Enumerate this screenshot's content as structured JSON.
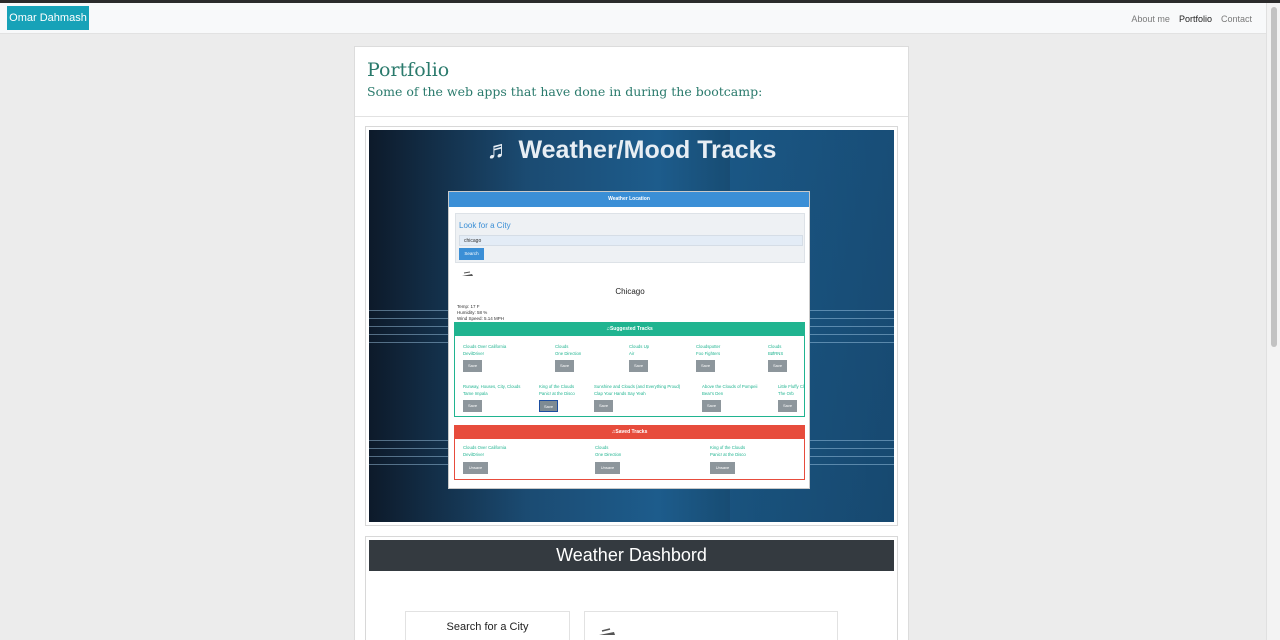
{
  "navbar": {
    "brand": "Omar Dahmash",
    "links": [
      "About me",
      "Portfolio",
      "Contact"
    ]
  },
  "header": {
    "title": "Portfolio",
    "subtitle": "Some of the web apps that have done in during the bootcamp:"
  },
  "project1": {
    "title": "Weather/Mood Tracks",
    "app_header": "Weather Location",
    "look_title": "Look for a City",
    "search_value": "chicago",
    "search_button": "Search",
    "city": "Chicago",
    "temp": "Temp: 17 F",
    "humidity": "Humidity: 58 %",
    "wind": "Wind Speed: 5.14 MPH",
    "suggested_header": "Suggested Tracks",
    "saved_header": "Saved Tracks",
    "save_label": "Save",
    "unsave_label": "Unsave",
    "suggested_tracks": [
      {
        "title": "Clouds Over California",
        "artist": "DevilDriver"
      },
      {
        "title": "Clouds",
        "artist": "One Direction"
      },
      {
        "title": "Clouds Up",
        "artist": "Air"
      },
      {
        "title": "Cloudspotter",
        "artist": "Foo Fighters"
      },
      {
        "title": "Clouds",
        "artist": "BØRNS"
      },
      {
        "title": "Runway, Houses, City, Clouds",
        "artist": "Tame Impala"
      },
      {
        "title": "King of the Clouds",
        "artist": "Panic! at the Disco"
      },
      {
        "title": "Sunshine and Clouds (and Everything Proud)",
        "artist": "Clap Your Hands Say Yeah"
      },
      {
        "title": "Above the Clouds of Pompeii",
        "artist": "Bear's Den"
      },
      {
        "title": "Little Fluffy Clo...",
        "artist": "The Orb"
      }
    ],
    "saved_tracks": [
      {
        "title": "Clouds Over California",
        "artist": "DevilDriver"
      },
      {
        "title": "Clouds",
        "artist": "One Direction"
      },
      {
        "title": "King of the Clouds",
        "artist": "Panic! at the Disco"
      }
    ]
  },
  "project2": {
    "title": "Weather Dashbord",
    "search_title": "Search for a City"
  }
}
